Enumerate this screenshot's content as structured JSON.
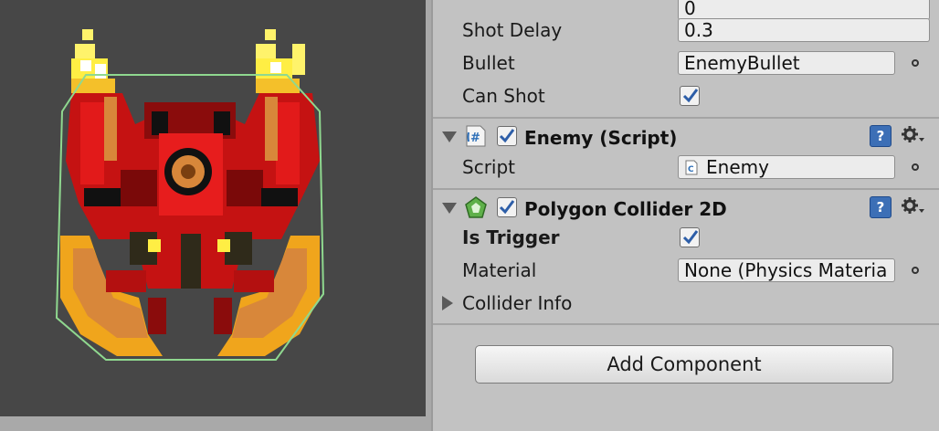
{
  "inspector": {
    "top_field_value": "0",
    "shot_delay": {
      "label": "Shot Delay",
      "value": "0.3"
    },
    "bullet": {
      "label": "Bullet",
      "value": "EnemyBullet"
    },
    "can_shot": {
      "label": "Can Shot",
      "checked": true
    },
    "enemy_component": {
      "title": "Enemy (Script)",
      "icon": "csharp-script-icon",
      "enabled": true,
      "script_label": "Script",
      "script_value": "Enemy"
    },
    "collider_component": {
      "title": "Polygon Collider 2D",
      "icon": "polygon-collider-icon",
      "enabled": true,
      "is_trigger_label": "Is Trigger",
      "is_trigger": true,
      "material_label": "Material",
      "material_value": "None (Physics Materia",
      "collider_info_label": "Collider Info"
    },
    "help_glyph": "?",
    "add_component_label": "Add Component"
  },
  "colors": {
    "scene_background": "#474747",
    "inspector_background": "#c2c2c2",
    "checkmark": "#2d5ea8",
    "collider_outline": "#8fd88f"
  }
}
